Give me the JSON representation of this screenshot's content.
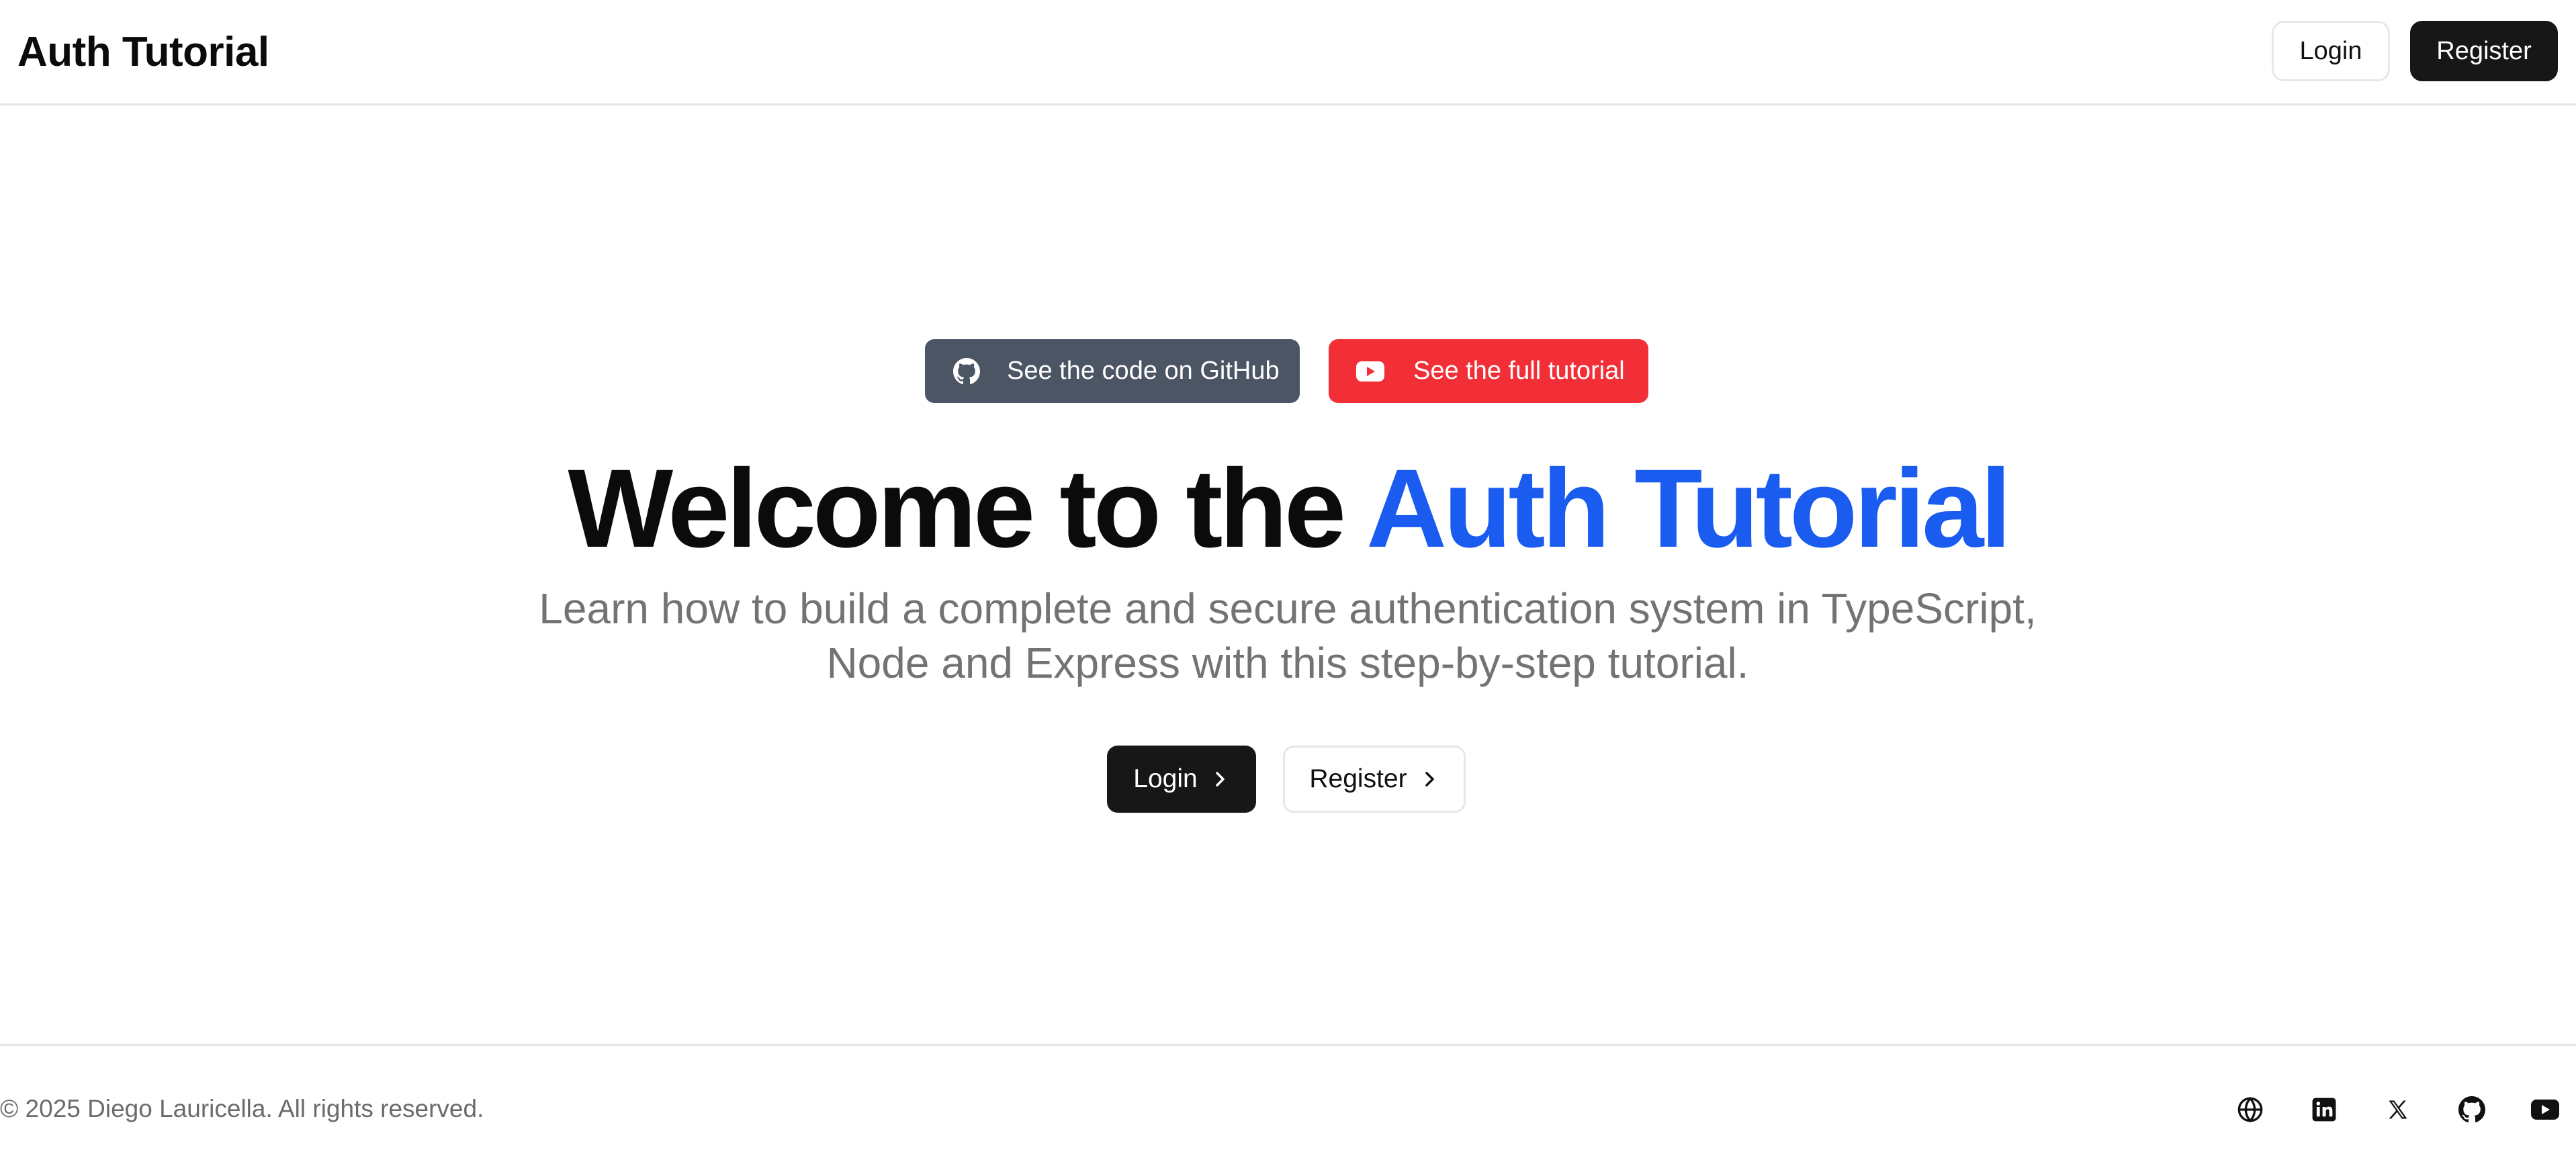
{
  "header": {
    "brand": "Auth Tutorial",
    "login_label": "Login",
    "register_label": "Register"
  },
  "hero": {
    "github_button_label": "See the code on GitHub",
    "github_button_icon": "github-icon",
    "youtube_button_label": "See the full tutorial",
    "youtube_button_icon": "youtube-icon",
    "title_plain": "Welcome to the ",
    "title_accent": "Auth Tutorial",
    "subtitle_line1": "Learn how to build a complete and secure authentication system in TypeScript,",
    "subtitle_line2": "Node and Express with this step-by-step tutorial.",
    "login_label": "Login",
    "register_label": "Register"
  },
  "footer": {
    "copyright": "© 2025 Diego Lauricella. All rights reserved.",
    "social_icons": [
      "globe-icon",
      "linkedin-icon",
      "x-icon",
      "github-icon",
      "youtube-icon"
    ]
  },
  "colors": {
    "accent": "#1a5cf0",
    "github_button": "#4b5563",
    "youtube_button": "#f22f36",
    "primary_button": "#171717",
    "muted_text": "#737373"
  }
}
